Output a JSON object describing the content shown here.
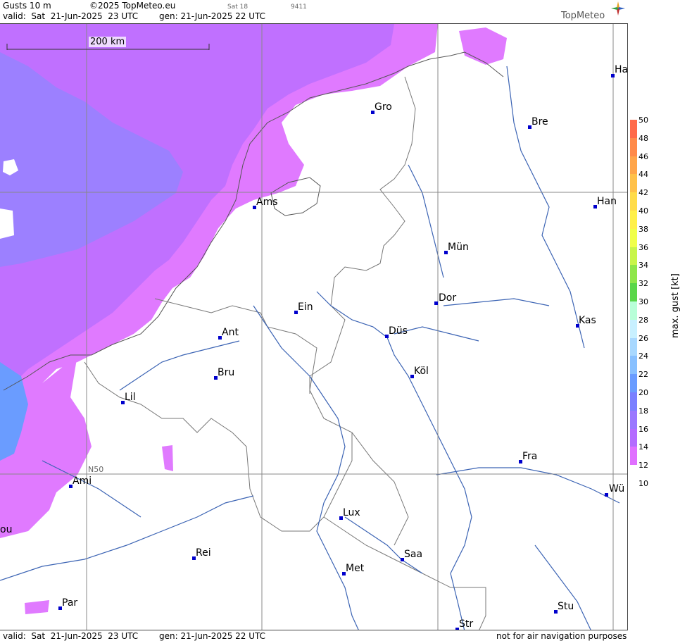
{
  "header": {
    "product": "Gusts 10 m",
    "copyright": "©2025 TopMeteo.eu",
    "sat": "Sat 18",
    "code": "9411",
    "valid": "valid:  Sat  21-Jun-2025  23 UTC",
    "gen": "gen: 21-Jun-2025 22 UTC",
    "logo": "TopMeteo"
  },
  "footer": {
    "valid": "valid:  Sat  21-Jun-2025  23 UTC",
    "gen": "gen: 21-Jun-2025 22 UTC",
    "disclaimer": "not for air navigation purposes"
  },
  "map": {
    "scale_label": "200 km",
    "grid_label": "N50",
    "cities": [
      {
        "id": "gro",
        "label": "Gro"
      },
      {
        "id": "bre",
        "label": "Bre"
      },
      {
        "id": "ha",
        "label": "Ha"
      },
      {
        "id": "ams",
        "label": "Ams"
      },
      {
        "id": "han",
        "label": "Han"
      },
      {
        "id": "mun",
        "label": "Mün"
      },
      {
        "id": "dor",
        "label": "Dor"
      },
      {
        "id": "ein",
        "label": "Ein"
      },
      {
        "id": "kas",
        "label": "Kas"
      },
      {
        "id": "ant",
        "label": "Ant"
      },
      {
        "id": "dus",
        "label": "Düs"
      },
      {
        "id": "bru",
        "label": "Bru"
      },
      {
        "id": "kol",
        "label": "Köl"
      },
      {
        "id": "lil",
        "label": "Lil"
      },
      {
        "id": "fra",
        "label": "Fra"
      },
      {
        "id": "ami",
        "label": "Ami"
      },
      {
        "id": "wur",
        "label": "Wü"
      },
      {
        "id": "lux",
        "label": "Lux"
      },
      {
        "id": "bou",
        "label": "ou"
      },
      {
        "id": "rei",
        "label": "Rei"
      },
      {
        "id": "saa",
        "label": "Saa"
      },
      {
        "id": "met",
        "label": "Met"
      },
      {
        "id": "par",
        "label": "Par"
      },
      {
        "id": "stu",
        "label": "Stu"
      },
      {
        "id": "str",
        "label": "Str"
      }
    ]
  },
  "legend": {
    "title": "max. gust [kt]",
    "ticks": [
      "50",
      "48",
      "46",
      "44",
      "42",
      "40",
      "38",
      "36",
      "34",
      "32",
      "30",
      "28",
      "26",
      "24",
      "22",
      "20",
      "18",
      "16",
      "14",
      "12",
      "10"
    ],
    "colors": [
      "#ff6a4a",
      "#ff8a4a",
      "#ffa54a",
      "#ffc14a",
      "#ffdc4a",
      "#fff04a",
      "#f0ff4a",
      "#c8f54a",
      "#8ee64a",
      "#5ad64a",
      "#b8ffd8",
      "#c8f0ff",
      "#a8d8ff",
      "#88c0ff",
      "#6a9cff",
      "#7a80ff",
      "#9a78ff",
      "#b46cff",
      "#e070ff"
    ]
  }
}
